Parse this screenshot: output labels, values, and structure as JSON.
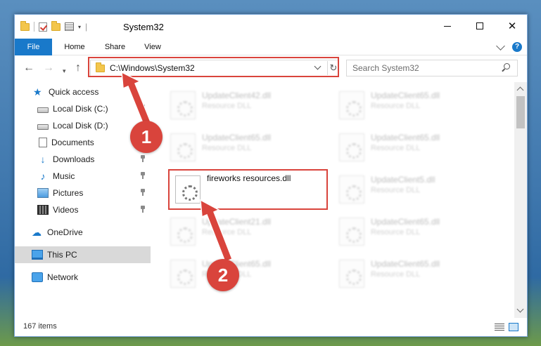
{
  "window": {
    "title": "System32",
    "controls": {
      "minimize": "minimize",
      "maximize": "maximize",
      "close": "✕"
    }
  },
  "ribbon": {
    "tabs": [
      {
        "label": "File"
      },
      {
        "label": "Home"
      },
      {
        "label": "Share"
      },
      {
        "label": "View"
      }
    ],
    "help": "?"
  },
  "address": {
    "path": "C:\\Windows\\System32",
    "refresh_glyph": "↻"
  },
  "search": {
    "placeholder": "Search System32"
  },
  "nav": {
    "back": "←",
    "forward": "→",
    "recent": "▾",
    "up": "↑"
  },
  "sidebar": {
    "items": [
      {
        "label": "Quick access",
        "icon": "star-icon"
      },
      {
        "label": "Local Disk (C:)",
        "icon": "disk-icon",
        "pinned": true
      },
      {
        "label": "Local Disk (D:)",
        "icon": "disk-icon"
      },
      {
        "label": "Documents",
        "icon": "documents-icon"
      },
      {
        "label": "Downloads",
        "icon": "downloads-icon",
        "pinned": true
      },
      {
        "label": "Music",
        "icon": "music-icon",
        "pinned": true
      },
      {
        "label": "Pictures",
        "icon": "pictures-icon",
        "pinned": true
      },
      {
        "label": "Videos",
        "icon": "videos-icon",
        "pinned": true
      },
      {
        "label": "OneDrive",
        "icon": "cloud-icon"
      },
      {
        "label": "This PC",
        "icon": "computer-icon",
        "selected": true
      },
      {
        "label": "Network",
        "icon": "network-icon"
      }
    ]
  },
  "files": {
    "left_column": [
      {
        "name": "UpdateClient42.dll",
        "type": "Resource DLL"
      },
      {
        "name": "UpdateClient65.dll",
        "type": "Resource DLL"
      },
      {
        "name": "fireworks resources.dll",
        "type": ""
      },
      {
        "name": "UpdateClient21.dll",
        "type": "Resource DLL"
      },
      {
        "name": "UpdateClient65.dll",
        "type": "Resource DLL"
      }
    ],
    "right_column": [
      {
        "name": "UpdateClient65.dll",
        "type": "Resource DLL"
      },
      {
        "name": "UpdateClient65.dll",
        "type": "Resource DLL"
      },
      {
        "name": "UpdateClient5.dll",
        "type": "Resource DLL"
      },
      {
        "name": "UpdateClient65.dll",
        "type": "Resource DLL"
      },
      {
        "name": "UpdateClient65.dll",
        "type": "Resource DLL"
      }
    ]
  },
  "callouts": {
    "step1": "1",
    "step2": "2"
  },
  "status": {
    "item_count": "167 items"
  },
  "colors": {
    "accent": "#1979ca",
    "highlight": "#d9443c",
    "selected_bg": "#d9d9d9"
  }
}
